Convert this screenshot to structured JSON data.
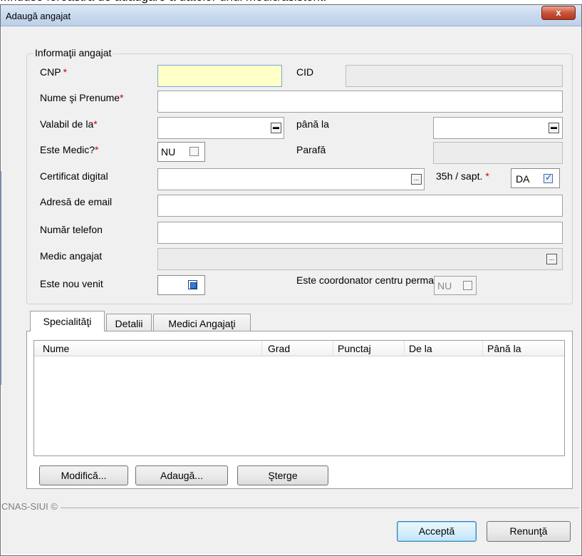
{
  "caption": "...nduse fereastra de adaugare a datelor unui medic/asistent:",
  "window": {
    "title": "Adaugă angajat",
    "close_label": "x"
  },
  "group": {
    "legend": "Informaţii angajat"
  },
  "form": {
    "cnp": {
      "label": "CNP",
      "required": "*",
      "value": ""
    },
    "cid": {
      "label": "CID",
      "value": ""
    },
    "nume": {
      "label": "Nume şi Prenume",
      "required": "*",
      "value": ""
    },
    "valabil_de_la": {
      "label": "Valabil de la",
      "required": "*",
      "value": ""
    },
    "pana_la": {
      "label": "până la",
      "value": ""
    },
    "este_medic": {
      "label": "Este Medic?",
      "required": "*",
      "value": "NU",
      "checked": false
    },
    "parafa": {
      "label": "Parafă",
      "value": ""
    },
    "certificat": {
      "label": "Certificat digital",
      "value": "",
      "browse": "..."
    },
    "ore": {
      "label": "35h / sapt.",
      "required": "*",
      "value": "DA",
      "checked": true
    },
    "email": {
      "label": "Adresă de email",
      "value": ""
    },
    "telefon": {
      "label": "Număr telefon",
      "value": ""
    },
    "medic_angajat": {
      "label": "Medic angajat",
      "value": "",
      "browse": "..."
    },
    "nou_venit": {
      "label": "Este nou venit",
      "checked": true
    },
    "coordonator": {
      "label": "Este coordonator centru permanenţă",
      "value": "NU",
      "checked": false
    }
  },
  "tabs": [
    {
      "label": "Specialităţi",
      "active": true
    },
    {
      "label": "Detalii",
      "active": false
    },
    {
      "label": "Medici Angajaţi",
      "active": false
    }
  ],
  "grid": {
    "columns": [
      "Nume",
      "Grad",
      "Punctaj",
      "De la",
      "Până la"
    ],
    "rows": []
  },
  "grid_buttons": {
    "modify": "Modifică...",
    "add": "Adaugă...",
    "delete": "Şterge"
  },
  "footer": {
    "brand": "CNAS-SIUI ©"
  },
  "dialog_buttons": {
    "accept": "Acceptă",
    "cancel": "Renunţă"
  },
  "colors": {
    "title_bar": "#c7d9ee",
    "close_button": "#c9553c",
    "required": "#d00000",
    "cnp_field": "#ffffc8"
  }
}
